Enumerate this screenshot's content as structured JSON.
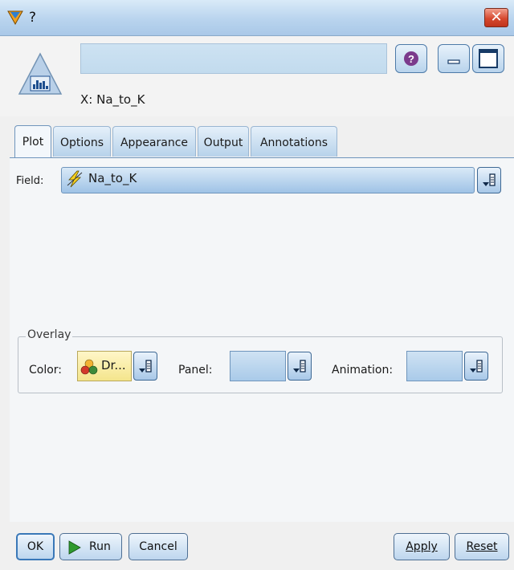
{
  "window": {
    "title": "?"
  },
  "header": {
    "subtitle": "X: Na_to_K"
  },
  "tabs": [
    {
      "label": "Plot",
      "active": true
    },
    {
      "label": "Options",
      "active": false
    },
    {
      "label": "Appearance",
      "active": false
    },
    {
      "label": "Output",
      "active": false
    },
    {
      "label": "Annotations",
      "active": false
    }
  ],
  "plot": {
    "field_label": "Field:",
    "field_value": "Na_to_K",
    "overlay": {
      "legend": "Overlay",
      "color_label": "Color:",
      "color_value": "Dr...",
      "panel_label": "Panel:",
      "panel_value": "",
      "animation_label": "Animation:",
      "animation_value": ""
    }
  },
  "buttons": {
    "ok": "OK",
    "run": "Run",
    "cancel": "Cancel",
    "apply": "Apply",
    "reset": "Reset"
  },
  "icons": {
    "app": "gem-icon",
    "help": "help-icon",
    "minimize": "minimize-icon",
    "maximize": "maximize-icon",
    "close": "close-icon",
    "node": "histogram-node-icon",
    "field_type": "continuous-lightning-icon",
    "color_field": "nominal-circles-icon",
    "run": "play-icon",
    "dropdown": "dropdown-icon"
  },
  "colors": {
    "titlebar": "#b9d4ee",
    "close": "#d6492f",
    "accent": "#6f95bc",
    "run_arrow": "#2e9a2e"
  }
}
